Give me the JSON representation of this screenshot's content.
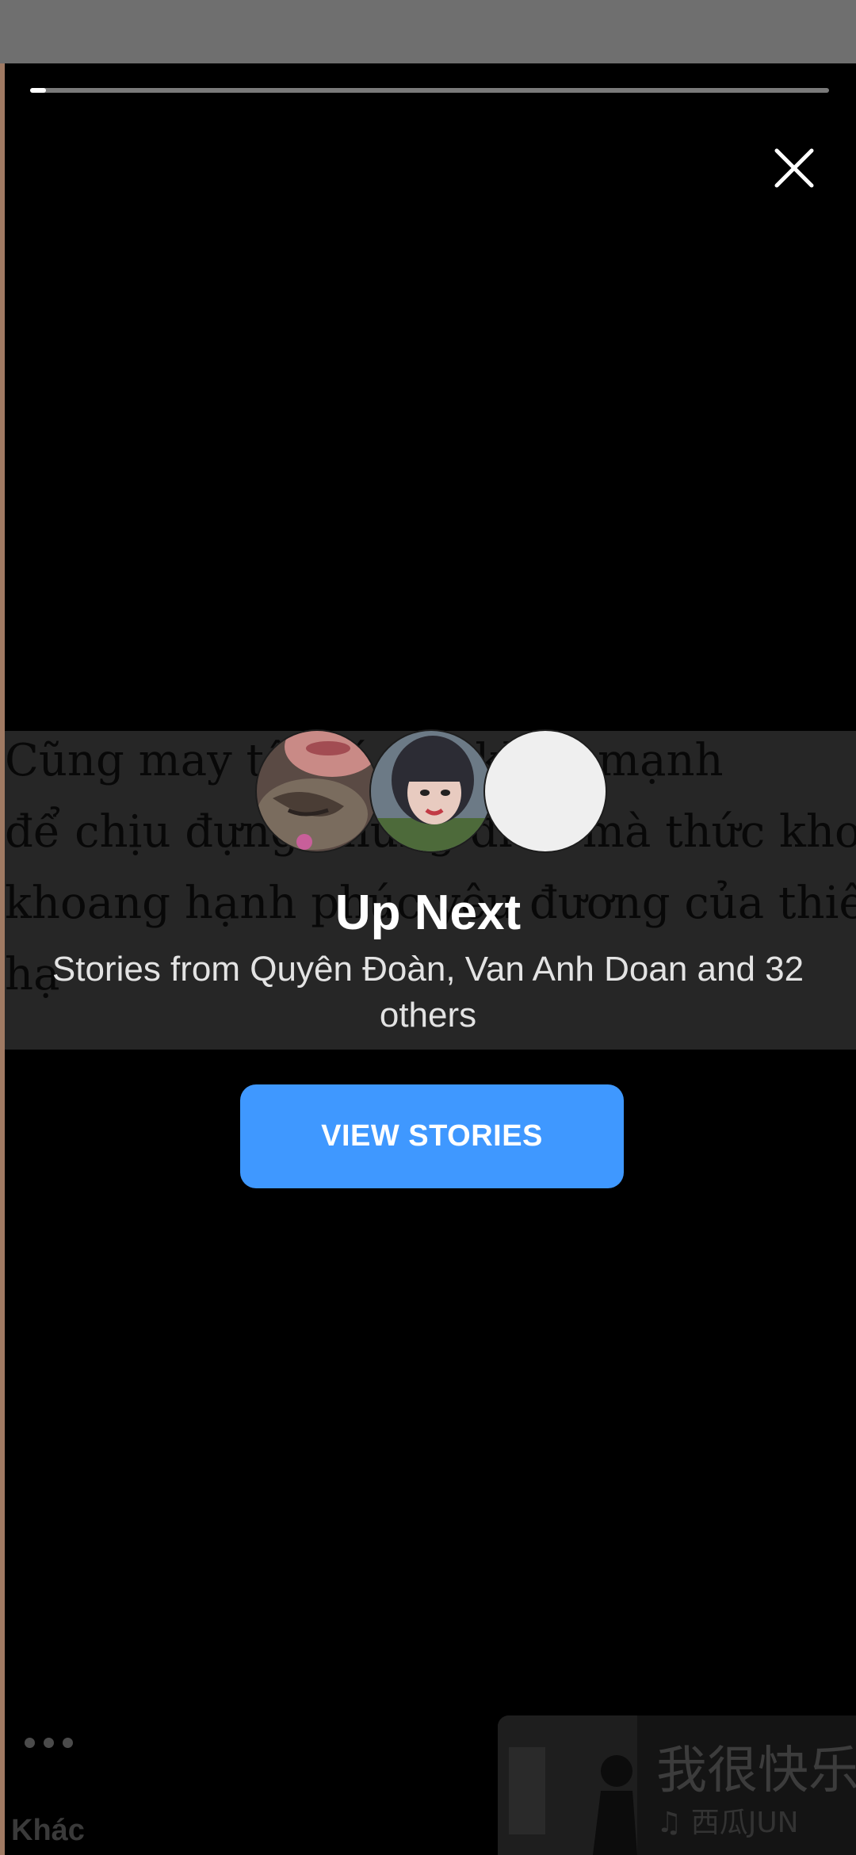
{
  "story": {
    "progress": 0.02
  },
  "background_text": {
    "lines": [
      "Cũng may tôi có sức khỏe mạnh",
      "để chịu đựng những điều mà thức khoe",
      "khoang hạnh phúc yêu đương của thiên",
      "hạ"
    ]
  },
  "up_next": {
    "title": "Up Next",
    "subtitle": "Stories from Quyên Đoàn, Van Anh Doan and 32 others",
    "button_label": "VIEW STORIES"
  },
  "footer": {
    "more_label": "Khác",
    "music": {
      "title": "我很快乐",
      "artist": "♫ 西瓜JUN"
    }
  },
  "colors": {
    "accent": "#3f98ff",
    "background": "#000000",
    "status_bar": "#6f6f6f"
  },
  "icons": [
    "close-icon",
    "more-dots-icon",
    "music-note-icon"
  ]
}
